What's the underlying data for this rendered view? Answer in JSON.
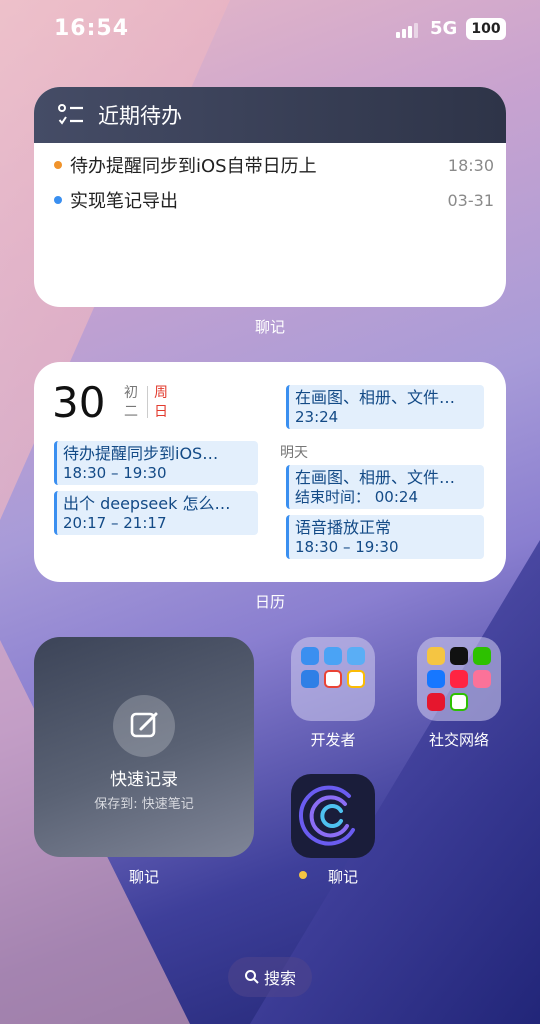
{
  "status_bar": {
    "time": "16:54",
    "network": "5G",
    "battery": "100"
  },
  "todo_widget": {
    "title": "近期待办",
    "items": [
      {
        "text": "待办提醒同步到iOS自带日历上",
        "time": "18:30",
        "dot_color": "#f0932b"
      },
      {
        "text": "实现笔记导出",
        "time": "03-31",
        "dot_color": "#3a8ff0"
      }
    ],
    "caption": "聊记"
  },
  "calendar_widget": {
    "day": "30",
    "lunar": [
      "初",
      "二"
    ],
    "weekday": [
      "周",
      "日"
    ],
    "today_events": [
      {
        "title": "待办提醒同步到iOS…",
        "time": "18:30 – 19:30"
      },
      {
        "title": "出个 deepseek 怎么…",
        "time": "20:17 – 21:17"
      }
    ],
    "right_event": {
      "title": "在画图、相册、文件…",
      "time": "23:24"
    },
    "tomorrow_label": "明天",
    "tomorrow_events": [
      {
        "title": "在画图、相册、文件…",
        "time": "结束时间： 00:24"
      },
      {
        "title": "语音播放正常",
        "time": "18:30 – 19:30"
      }
    ],
    "caption": "日历"
  },
  "quick_note_widget": {
    "title": "快速记录",
    "subtitle": "保存到: 快速笔记",
    "caption": "聊记"
  },
  "apps": {
    "developer_folder": {
      "label": "开发者",
      "icons": [
        "app-store-icon",
        "app-store-icon",
        "testflight-icon",
        "app-store-icon",
        "gmail-icon",
        "google-ads-icon"
      ]
    },
    "social_folder": {
      "label": "社交网络",
      "icons": [
        "mail-icon",
        "qq-icon",
        "wechat-icon",
        "alipay-icon",
        "xiaohongshu-icon",
        "bilibili-icon",
        "weibo-icon",
        "app-icon"
      ]
    },
    "liaoji_app": {
      "label": "聊记",
      "badge_dot_color": "#f5c542"
    }
  },
  "search": {
    "label": "搜索"
  }
}
